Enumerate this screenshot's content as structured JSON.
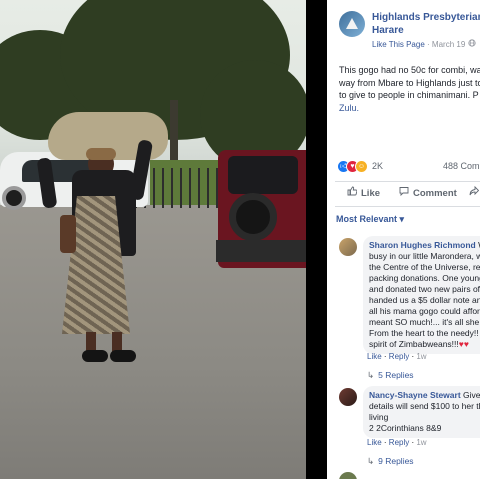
{
  "post": {
    "page_name_line1": "Highlands Presbyterian C",
    "page_name_line2": "Harare",
    "liked_label": "Like This Page",
    "separator": "·",
    "date": "March 19",
    "text_lines": [
      "This gogo had no 50c for combi, wa",
      "way from Mbare to Highlands just to",
      "to give to people in chimanimani. P"
    ],
    "tag": "Zulu."
  },
  "reactions": {
    "count": "2K",
    "comments": "488 Comm"
  },
  "actions": {
    "like": "Like",
    "comment": "Comment"
  },
  "sort": {
    "label": "Most Relevant",
    "arrow": "▾"
  },
  "comments": [
    {
      "name": "Sharon Hughes Richmond",
      "name_suffix": " W",
      "lines": [
        "busy in our little Marondera, w",
        "the Centre of the Universe, rec",
        "packing donations. One young",
        "and donated two new pairs of",
        "handed us a $5 dollar note and",
        "all his mama gogo could afford",
        "meant SO much!... it's all she",
        "From the heart to the needy!! T",
        "spirit of Zimbabweans!!!"
      ],
      "hearts": "♥♥",
      "like": "Like",
      "reply": "Reply",
      "time": "1w",
      "replies": "5 Replies"
    },
    {
      "name": "Nancy-Shayne Stewart",
      "name_suffix": " Give",
      "lines": [
        "details will send $100 to her th",
        "living",
        "2 2Corinthians 8&9"
      ],
      "like": "Like",
      "reply": "Reply",
      "time": "1w",
      "replies": "9 Replies"
    }
  ],
  "colors": {
    "link_blue": "#385898",
    "meta_gray": "#90949c",
    "like_blue": "#1877f2",
    "haha_yellow": "#f7b125",
    "love_red": "#e0253e"
  },
  "icons": [
    "like-reaction-icon",
    "love-reaction-icon",
    "haha-reaction-icon",
    "thumbs-up-icon",
    "speech-bubble-icon",
    "share-arrow-icon",
    "reply-arrow-icon",
    "globe-icon"
  ]
}
